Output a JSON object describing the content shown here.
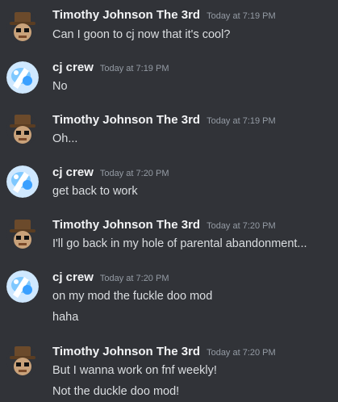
{
  "messages": [
    {
      "author": "Timothy Johnson The 3rd",
      "avatar": "brown-hat-face-avatar",
      "timestamp": "Today at 7:19 PM",
      "lines": [
        "Can I goon to cj now that it's cool?"
      ]
    },
    {
      "author": "cj crew",
      "avatar": "blue-white-character-avatar",
      "timestamp": "Today at 7:19 PM",
      "lines": [
        "No"
      ]
    },
    {
      "author": "Timothy Johnson The 3rd",
      "avatar": "brown-hat-face-avatar",
      "timestamp": "Today at 7:19 PM",
      "lines": [
        "Oh..."
      ]
    },
    {
      "author": "cj crew",
      "avatar": "blue-white-character-avatar",
      "timestamp": "Today at 7:20 PM",
      "lines": [
        "get back to work"
      ]
    },
    {
      "author": "Timothy Johnson The 3rd",
      "avatar": "brown-hat-face-avatar",
      "timestamp": "Today at 7:20 PM",
      "lines": [
        "I'll go back in my hole of parental abandonment..."
      ]
    },
    {
      "author": "cj crew",
      "avatar": "blue-white-character-avatar",
      "timestamp": "Today at 7:20 PM",
      "lines": [
        "on my mod the fuckle doo mod",
        "haha"
      ]
    },
    {
      "author": "Timothy Johnson The 3rd",
      "avatar": "brown-hat-face-avatar",
      "timestamp": "Today at 7:20 PM",
      "lines": [
        "But I wanna work on fnf weekly!",
        "Not the duckle doo mod!"
      ]
    }
  ],
  "colors": {
    "background": "#313338",
    "author": "#f2f3f5",
    "timestamp": "#949ba4",
    "text": "#dbdee1"
  }
}
